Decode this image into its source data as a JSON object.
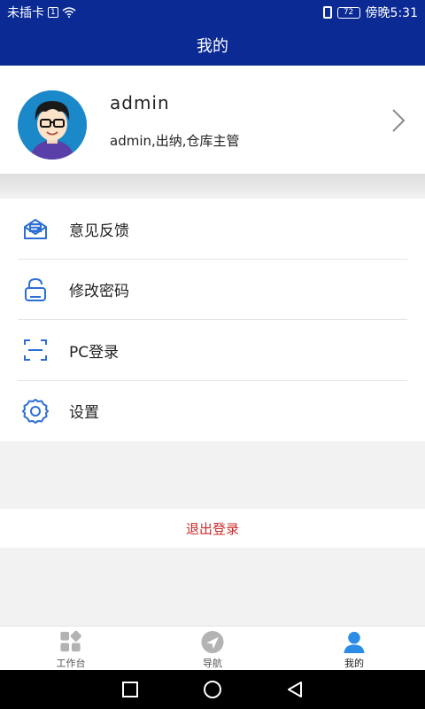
{
  "status_bar": {
    "carrier": "未插卡",
    "sim_badge": "1",
    "battery": "72",
    "time": "傍晚5:31"
  },
  "header": {
    "title": "我的"
  },
  "profile": {
    "username": "admin",
    "roles": "admin,出纳,仓库主管"
  },
  "menu": {
    "items": [
      {
        "label": "意见反馈",
        "icon": "feedback-mail-icon"
      },
      {
        "label": "修改密码",
        "icon": "lock-icon"
      },
      {
        "label": "PC登录",
        "icon": "scan-icon"
      },
      {
        "label": "设置",
        "icon": "gear-icon"
      }
    ]
  },
  "logout": {
    "label": "退出登录"
  },
  "tabs": [
    {
      "label": "工作台",
      "icon": "workbench-icon",
      "active": false
    },
    {
      "label": "导航",
      "icon": "navigation-icon",
      "active": false
    },
    {
      "label": "我的",
      "icon": "user-icon",
      "active": true
    }
  ],
  "colors": {
    "primary": "#0b2a94",
    "icon_blue": "#2b6fd6",
    "logout_red": "#cc2a2a",
    "tab_active": "#2b8de8",
    "tab_inactive": "#b3b3b3"
  }
}
